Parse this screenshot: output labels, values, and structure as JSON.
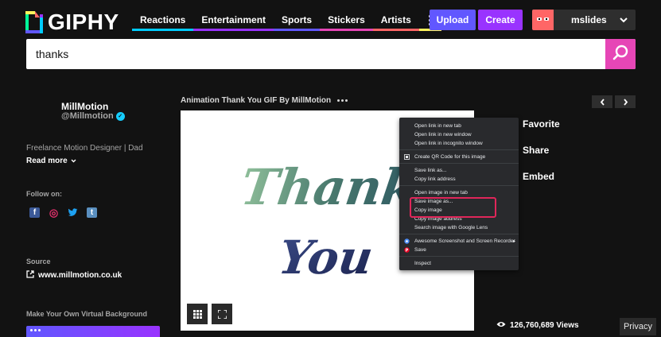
{
  "brand": {
    "name": "GIPHY",
    "colors": {
      "green": "#00ff99",
      "blue": "#00ccff",
      "purple": "#9933ff",
      "pink": "#ff6666",
      "yellow": "#fff35c"
    }
  },
  "nav": {
    "items": [
      {
        "label": "Reactions",
        "color": "#00ccff"
      },
      {
        "label": "Entertainment",
        "color": "#9933ff"
      },
      {
        "label": "Sports",
        "color": "#6157ff"
      },
      {
        "label": "Stickers",
        "color": "#e646b6"
      },
      {
        "label": "Artists",
        "color": "#ff6666"
      },
      {
        "label": "",
        "color": "#fff35c"
      }
    ],
    "more_icon": "vertical-dots-icon"
  },
  "header": {
    "upload_label": "Upload",
    "upload_color": "#6157ff",
    "create_label": "Create",
    "create_color": "#9933ff",
    "username": "mslides",
    "avatar_color": "#ff6666"
  },
  "search": {
    "value": "thanks",
    "button_color": "#e646b6",
    "icon": "search-icon"
  },
  "creator": {
    "name": "MillMotion",
    "handle": "@Millmotion",
    "bio": "Freelance Motion Designer  |  Dad",
    "read_more": "Read more",
    "follow_label": "Follow on:",
    "socials": [
      {
        "name": "facebook-icon",
        "glyph": "f",
        "color": "#3b5998"
      },
      {
        "name": "instagram-icon",
        "glyph": "◎",
        "color": "#e1306c"
      },
      {
        "name": "twitter-icon",
        "glyph": "🐦",
        "color": "#1da1f2"
      },
      {
        "name": "tumblr-icon",
        "glyph": "t",
        "color": "#5a8fbf"
      }
    ],
    "source_label": "Source",
    "source_url": "www.millmotion.co.uk",
    "promo_label": "Make Your Own Virtual Background"
  },
  "gif": {
    "title": "Animation Thank You GIF By MillMotion",
    "text_line1": "Thank",
    "text_line2": "You",
    "views": "126,760,689 Views"
  },
  "actions": [
    "Favorite",
    "Share",
    "Embed"
  ],
  "context_menu": [
    {
      "label": "Open link in new tab"
    },
    {
      "label": "Open link in new window"
    },
    {
      "label": "Open link in incognito window"
    },
    {
      "label": "Create QR Code for this image",
      "icon": "qr-code-icon"
    },
    {
      "label": "Save link as..."
    },
    {
      "label": "Copy link address"
    },
    {
      "label": "Open image in new tab"
    },
    {
      "label": "Save image as..."
    },
    {
      "label": "Copy image"
    },
    {
      "label": "Copy image address"
    },
    {
      "label": "Search image with Google Lens"
    },
    {
      "label": "Awesome Screenshot and Screen Recorder",
      "icon": "screenshot-ext-icon"
    },
    {
      "label": "Save",
      "icon": "pinterest-icon"
    },
    {
      "label": "Inspect"
    }
  ],
  "privacy_label": "Privacy"
}
